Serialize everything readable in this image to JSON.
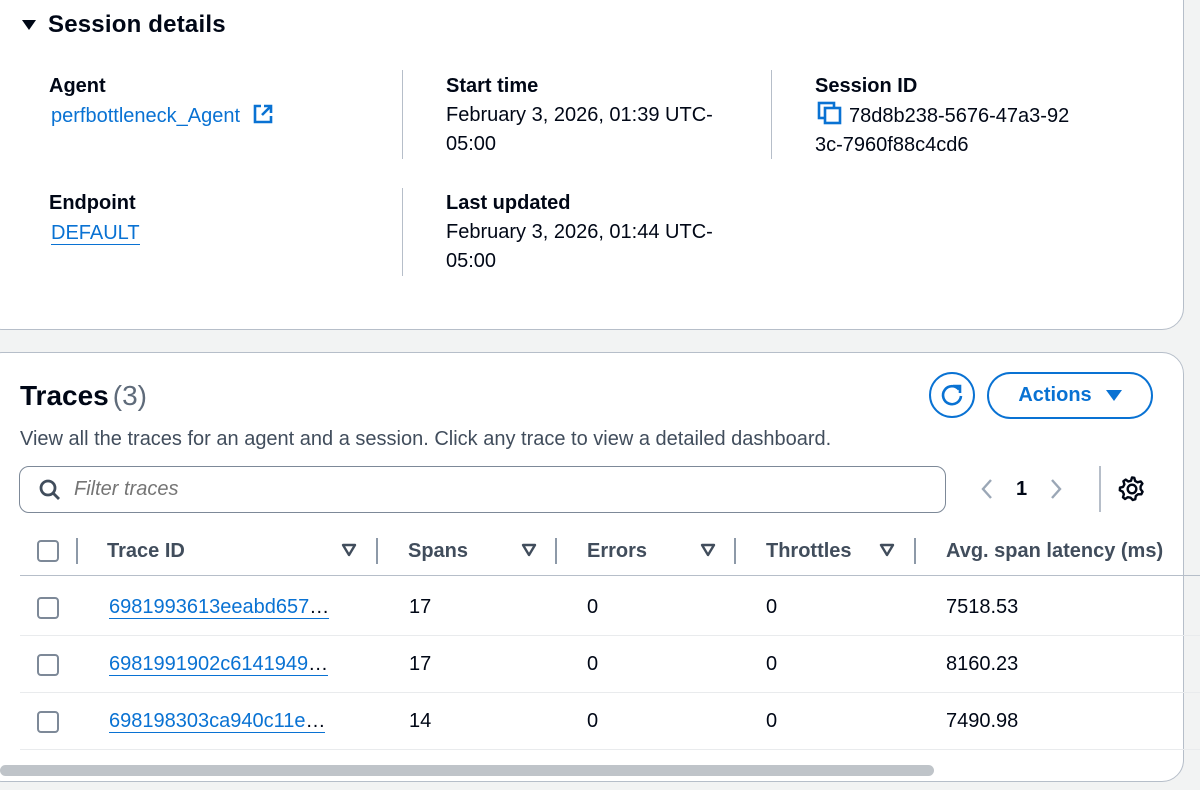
{
  "session": {
    "title": "Session details",
    "agent_label": "Agent",
    "agent_value": "perfbottleneck_Agent",
    "endpoint_label": "Endpoint",
    "endpoint_value": "DEFAULT",
    "start_label": "Start time",
    "start_line1": "February 3, 2026, 01:39 UTC-",
    "start_line2": "05:00",
    "updated_label": "Last updated",
    "updated_line1": "February 3, 2026, 01:44 UTC-",
    "updated_line2": "05:00",
    "session_id_label": "Session ID",
    "session_id_line1": "78d8b238-5676-47a3-92",
    "session_id_line2": "3c-7960f88c4cd6"
  },
  "traces": {
    "title": "Traces",
    "count": "(3)",
    "description": "View all the traces for an agent and a session. Click any trace to view a detailed dashboard.",
    "actions_label": "Actions",
    "filter_placeholder": "Filter traces",
    "page": "1",
    "columns": [
      "Trace ID",
      "Spans",
      "Errors",
      "Throttles",
      "Avg. span latency (ms)"
    ],
    "rows": [
      {
        "trace_id": "6981993613eeabd657",
        "spans": "17",
        "errors": "0",
        "throttles": "0",
        "latency": "7518.53"
      },
      {
        "trace_id": "6981991902c6141949",
        "spans": "17",
        "errors": "0",
        "throttles": "0",
        "latency": "8160.23"
      },
      {
        "trace_id": "698198303ca940c11e",
        "spans": "14",
        "errors": "0",
        "throttles": "0",
        "latency": "7490.98"
      }
    ],
    "ellipsis": "…"
  },
  "icons": {
    "expand": "caret-down-icon",
    "external": "external-link-icon",
    "copy": "copy-icon",
    "refresh": "refresh-icon",
    "search": "search-icon",
    "sort": "sort-icon",
    "settings": "gear-icon"
  },
  "colors": {
    "link": "#0972d3",
    "text": "#000716",
    "border": "#b6bec9"
  }
}
